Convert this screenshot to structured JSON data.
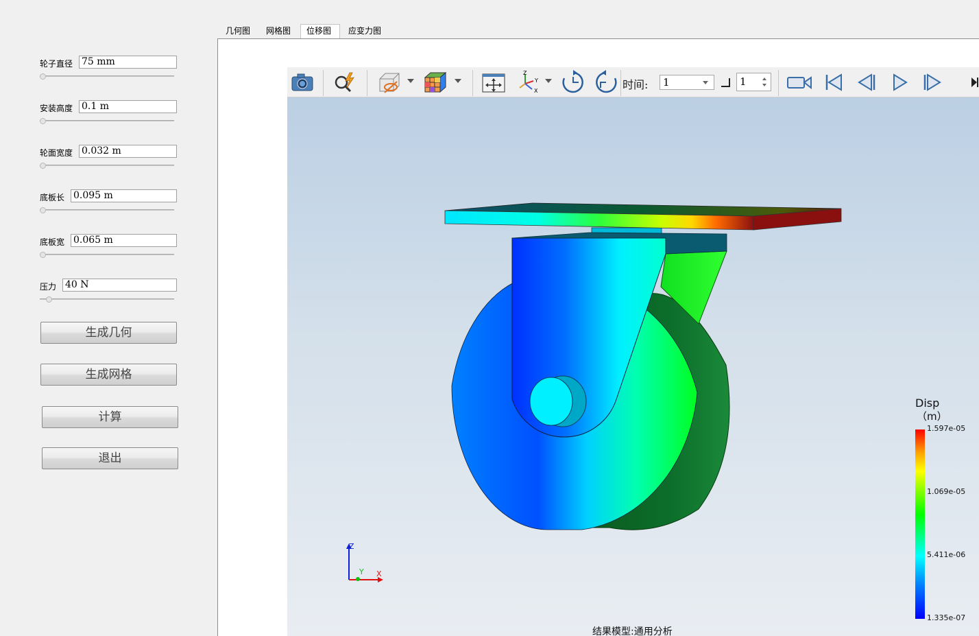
{
  "params": [
    {
      "label": "轮子直径",
      "value": "75 mm",
      "slider": 0.0
    },
    {
      "label": "安装高度",
      "value": "0.1 m",
      "slider": 0.0
    },
    {
      "label": "轮面宽度",
      "value": "0.032 m",
      "slider": 0.0
    },
    {
      "label": "底板长",
      "value": "0.095 m",
      "slider": 0.0
    },
    {
      "label": "底板宽",
      "value": "0.065 m",
      "slider": 0.0
    },
    {
      "label": "压力",
      "value": "40 N",
      "slider": 0.05
    }
  ],
  "buttons": {
    "gen_geometry": "生成几何",
    "gen_mesh": "生成网格",
    "compute": "计算",
    "exit": "退出"
  },
  "tabs": [
    {
      "label": "几何图",
      "active": false
    },
    {
      "label": "网格图",
      "active": false
    },
    {
      "label": "位移图",
      "active": true
    },
    {
      "label": "应变力图",
      "active": false
    }
  ],
  "toolbar": {
    "time_label": "时间:",
    "time_value": "1",
    "frame_value": "1"
  },
  "legend": {
    "title": "Disp",
    "unit": "（m）",
    "max": "1.597e-05",
    "mid_high": "1.069e-05",
    "mid_low": "5.411e-06",
    "min": "1.335e-07"
  },
  "axis_triad": {
    "z": "Z",
    "y": "Y",
    "x": "X"
  },
  "status": "结果模型:通用分析",
  "colors": {
    "legend_max": "#ff0000",
    "legend_min": "#0000ff",
    "background_top": "#b8cde3",
    "background_bottom": "#e9edf2"
  }
}
